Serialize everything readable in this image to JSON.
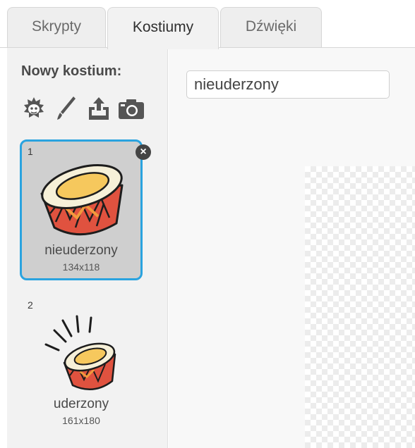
{
  "tabs": [
    {
      "label": "Skrypty",
      "active": false
    },
    {
      "label": "Kostiumy",
      "active": true
    },
    {
      "label": "Dźwięki",
      "active": false
    }
  ],
  "sidebar": {
    "new_costume_label": "Nowy kostium:",
    "new_costume_icons": [
      "choose-from-library-icon",
      "paint-brush-icon",
      "upload-icon",
      "camera-icon"
    ],
    "costumes": [
      {
        "index": "1",
        "name": "nieuderzony",
        "size": "134x118",
        "selected": true
      },
      {
        "index": "2",
        "name": "uderzony",
        "size": "161x180",
        "selected": false
      }
    ],
    "delete_icon": "close-icon"
  },
  "editor": {
    "costume_name_value": "nieuderzony"
  },
  "colors": {
    "selection_border": "#2aa3df",
    "drum_body": "#e0523f",
    "drum_top": "#f7d78a"
  }
}
